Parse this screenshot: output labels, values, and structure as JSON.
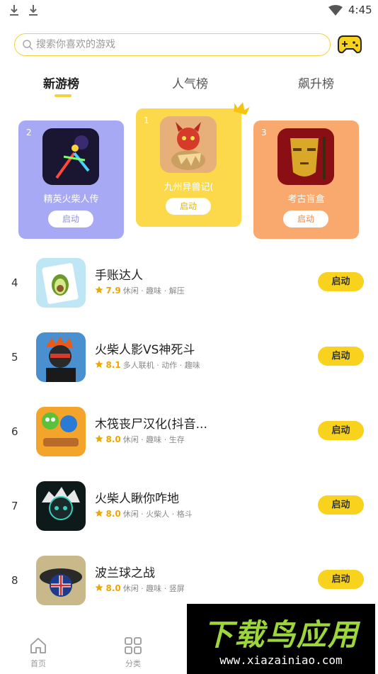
{
  "status_bar": {
    "time": "4:45"
  },
  "search": {
    "placeholder": "搜索你喜欢的游戏"
  },
  "tabs": [
    {
      "label": "新游榜",
      "active": true
    },
    {
      "label": "人气榜",
      "active": false
    },
    {
      "label": "飙升榜",
      "active": false
    }
  ],
  "podium": [
    {
      "rank": "2",
      "name": "精英火柴人传",
      "button": "启动",
      "color": "#a7a9f4"
    },
    {
      "rank": "1",
      "name": "九州异兽记(",
      "button": "启动",
      "color": "#fbd94a"
    },
    {
      "rank": "3",
      "name": "考古盲盒",
      "button": "启动",
      "color": "#f9a96e"
    }
  ],
  "list": [
    {
      "rank": "4",
      "title": "手账达人",
      "score": "7.9",
      "tags": "休闲 · 趣味 · 解压",
      "button": "启动"
    },
    {
      "rank": "5",
      "title": "火柴人影VS神死斗",
      "score": "8.1",
      "tags": "多人联机 · 动作 · 趣味",
      "button": "启动"
    },
    {
      "rank": "6",
      "title": "木筏丧尸汉化(抖音...",
      "score": "8.0",
      "tags": "休闲 · 趣味 · 生存",
      "button": "启动"
    },
    {
      "rank": "7",
      "title": "火柴人瞅你咋地",
      "score": "8.0",
      "tags": "休闲 · 火柴人 · 格斗",
      "button": "启动"
    },
    {
      "rank": "8",
      "title": "波兰球之战",
      "score": "8.0",
      "tags": "休闲 · 趣味 · 竖屏",
      "button": "启动"
    }
  ],
  "bottom_nav": [
    {
      "label": "首页",
      "icon": "home-icon"
    },
    {
      "label": "分类",
      "icon": "grid-icon"
    }
  ],
  "watermark": {
    "main": "下载鸟应用",
    "url": "www.xiazainiao.com"
  },
  "colors": {
    "accent": "#f8d21c",
    "score": "#f0a500"
  }
}
